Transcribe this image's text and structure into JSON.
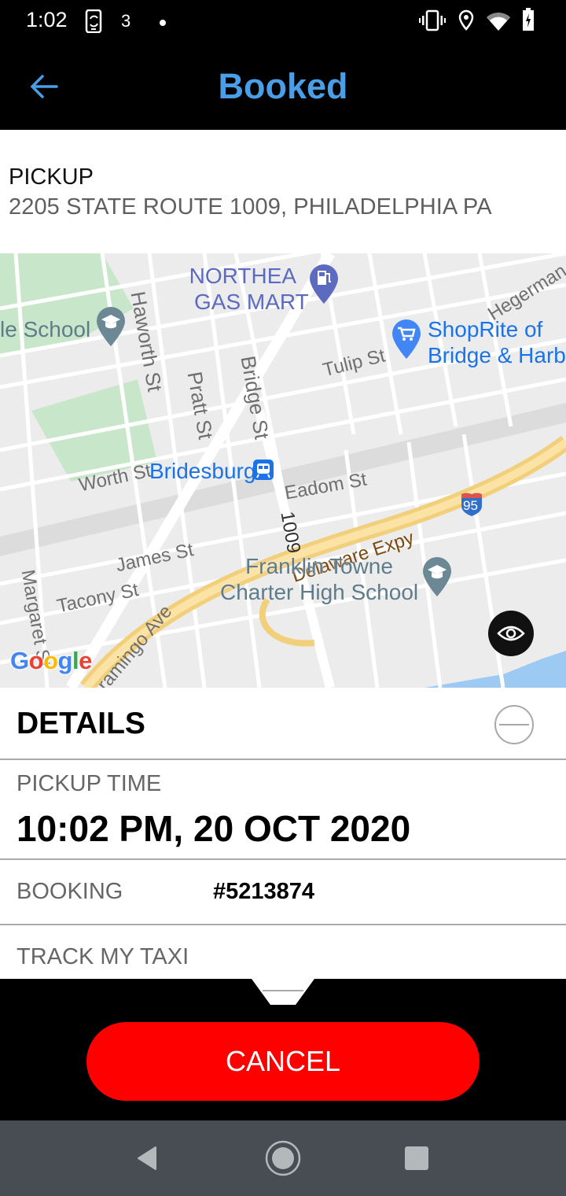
{
  "status_bar": {
    "time": "1:02",
    "notification_count": "3",
    "icons": [
      "screen-rotate-icon",
      "notification-dot-icon",
      "vibrate-icon",
      "location-icon",
      "wifi-icon",
      "battery-charging-icon"
    ]
  },
  "app_bar": {
    "title": "Booked",
    "back_icon": "arrow-left-icon"
  },
  "pickup": {
    "label": "PICKUP",
    "address": "2205 STATE ROUTE 1009, PHILADELPHIA PA"
  },
  "map": {
    "streets": [
      "Haworth St",
      "Pratt St",
      "Bridge St",
      "Tulip St",
      "Hegerman St",
      "Worth St",
      "Eadom St",
      "1009",
      "James St",
      "Tacony St",
      "Margaret St",
      "Aramingo Ave",
      "Delaware Expy"
    ],
    "pois": [
      {
        "name": "le School",
        "icon": "school-pin-icon"
      },
      {
        "name": "NORTHEAST GAS MART",
        "line1": "NORTHEA",
        "line2": "GAS MART",
        "icon": "gas-station-pin-icon"
      },
      {
        "name": "ShopRite of Bridge & Harbi",
        "line1": "ShopRite of",
        "line2": "Bridge & Harbi",
        "icon": "shopping-cart-pin-icon"
      },
      {
        "name": "Bridesburg",
        "icon": "train-station-icon"
      },
      {
        "name": "Franklin Towne Charter High School",
        "line1": "Franklin Towne",
        "line2": "Charter High School",
        "icon": "school-pin-icon"
      }
    ],
    "highway_shield": "95",
    "attribution": "Google",
    "colors": {
      "background": "#ececec",
      "road": "#ffffff",
      "park": "#c8e6c9",
      "highway": "#f7d98b",
      "water": "#9ccaf3",
      "poi_blue": "#1a73e8",
      "poi_purple": "#5c6bc0",
      "poi_school": "#5f7c8a"
    }
  },
  "details": {
    "title": "DETAILS",
    "pickup_time_label": "PICKUP TIME",
    "pickup_time_value": "10:02 PM, 20 OCT 2020",
    "booking_label": "BOOKING",
    "booking_value": "#5213874",
    "track_label": "TRACK MY TAXI"
  },
  "actions": {
    "cancel_label": "CANCEL"
  },
  "colors": {
    "accent": "#4a9ee8",
    "cancel": "#ff0000"
  }
}
